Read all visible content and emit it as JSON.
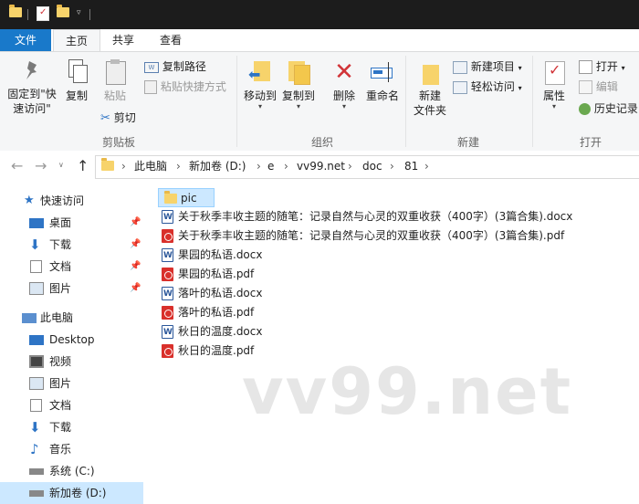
{
  "ribbon": {
    "tabs": [
      "文件",
      "主页",
      "共享",
      "查看"
    ],
    "active_tab": "主页",
    "clipboard": {
      "pin_label": "固定到\"快速访问\"",
      "copy_label": "复制",
      "paste_label": "粘贴",
      "copy_path_label": "复制路径",
      "paste_shortcut_label": "粘贴快捷方式",
      "cut_label": "剪切",
      "group_label": "剪贴板"
    },
    "organize": {
      "move_to_label": "移动到",
      "copy_to_label": "复制到",
      "delete_label": "删除",
      "rename_label": "重命名",
      "group_label": "组织"
    },
    "new": {
      "new_folder_label": "新建\n文件夹",
      "new_item_label": "新建项目",
      "easy_access_label": "轻松访问",
      "group_label": "新建"
    },
    "open": {
      "properties_label": "属性",
      "open_label": "打开",
      "edit_label": "编辑",
      "history_label": "历史记录",
      "group_label": "打开"
    }
  },
  "address": {
    "crumbs": [
      "此电脑",
      "新加卷 (D:)",
      "e",
      "vv99.net",
      "doc",
      "81"
    ]
  },
  "nav": {
    "quick_access_label": "快速访问",
    "items": [
      {
        "label": "桌面",
        "icon": "desktop-icon",
        "pinned": true
      },
      {
        "label": "下载",
        "icon": "download-icon",
        "pinned": true
      },
      {
        "label": "文档",
        "icon": "document-icon",
        "pinned": true
      },
      {
        "label": "图片",
        "icon": "picture-icon",
        "pinned": true
      }
    ],
    "this_pc_label": "此电脑",
    "pc_items": [
      {
        "label": "Desktop",
        "icon": "desktop-icon"
      },
      {
        "label": "视频",
        "icon": "video-icon"
      },
      {
        "label": "图片",
        "icon": "picture-icon"
      },
      {
        "label": "文档",
        "icon": "document-icon"
      },
      {
        "label": "下载",
        "icon": "download-icon"
      },
      {
        "label": "音乐",
        "icon": "music-icon"
      },
      {
        "label": "系统 (C:)",
        "icon": "drive-icon"
      },
      {
        "label": "新加卷 (D:)",
        "icon": "drive-icon"
      }
    ]
  },
  "files": [
    {
      "name": "pic",
      "type": "folder",
      "selected": true
    },
    {
      "name": "关于秋季丰收主题的随笔：记录自然与心灵的双重收获（400字）(3篇合集).docx",
      "type": "docx"
    },
    {
      "name": "关于秋季丰收主题的随笔：记录自然与心灵的双重收获（400字）(3篇合集).pdf",
      "type": "pdf"
    },
    {
      "name": "果园的私语.docx",
      "type": "docx"
    },
    {
      "name": "果园的私语.pdf",
      "type": "pdf"
    },
    {
      "name": "落叶的私语.docx",
      "type": "docx"
    },
    {
      "name": "落叶的私语.pdf",
      "type": "pdf"
    },
    {
      "name": "秋日的温度.docx",
      "type": "docx"
    },
    {
      "name": "秋日的温度.pdf",
      "type": "pdf"
    }
  ],
  "watermark": "vv99.net",
  "colors": {
    "file_tab": "#1979ca",
    "selection": "#cce8ff",
    "titlebar": "#1c1c1c"
  }
}
